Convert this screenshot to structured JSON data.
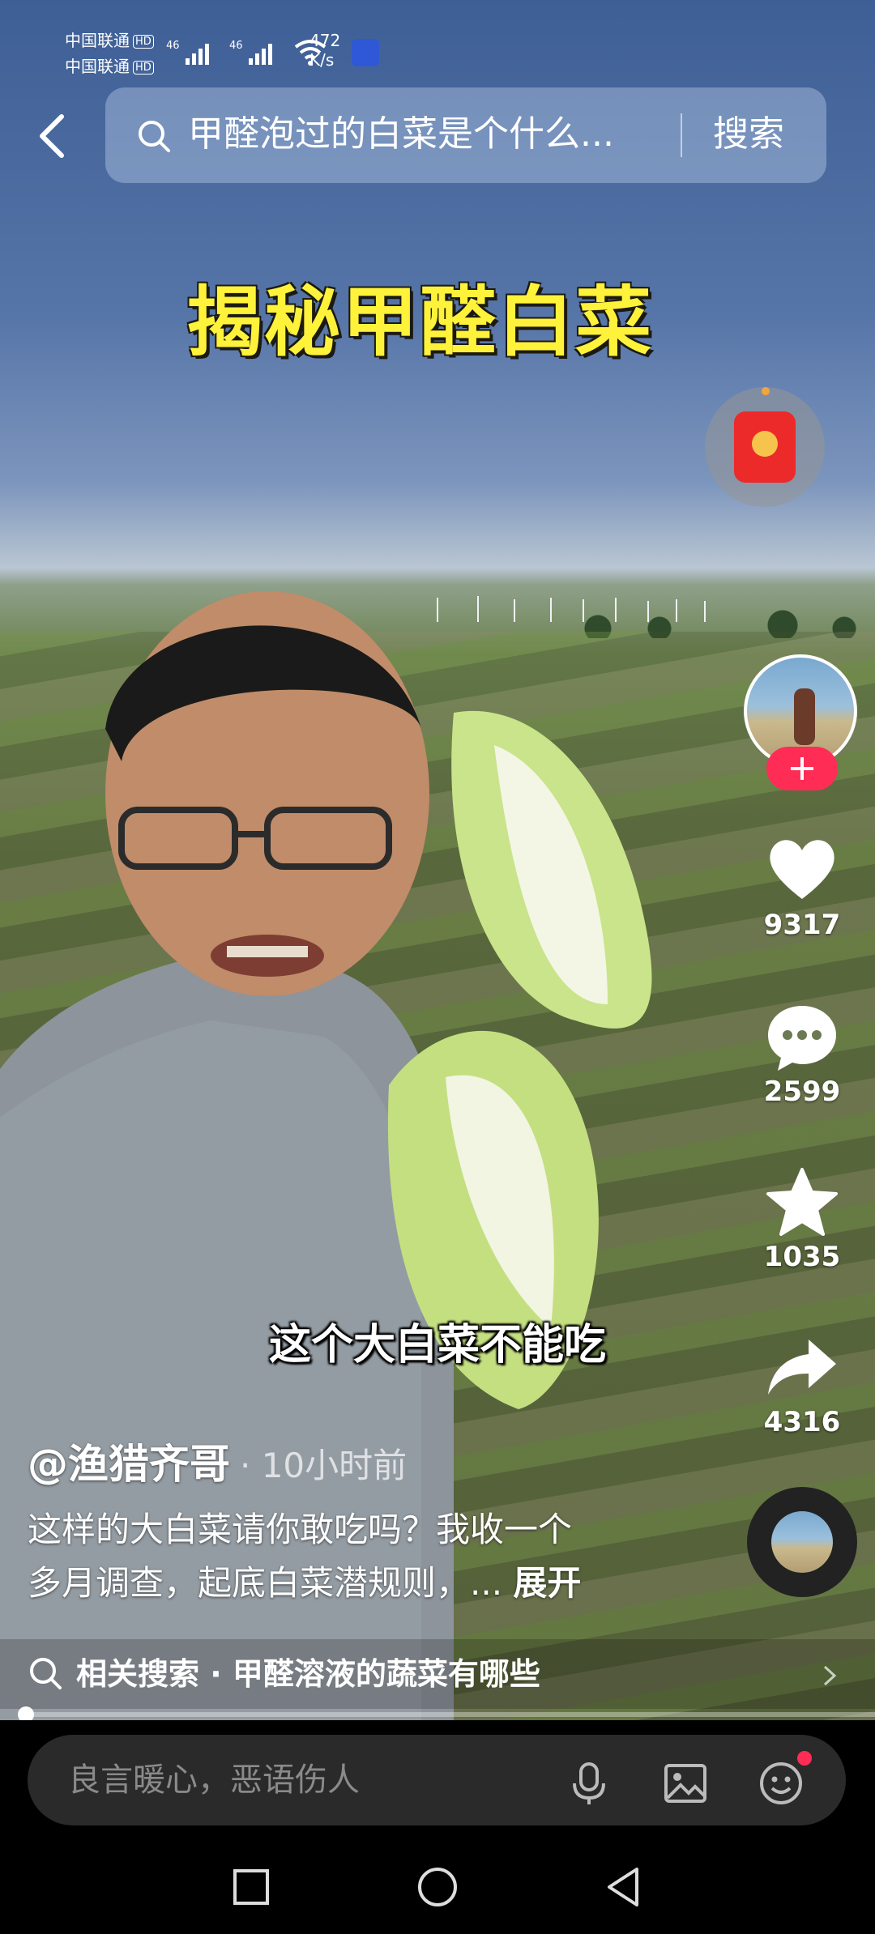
{
  "status_bar": {
    "carrier_1": "中国联通",
    "carrier_2": "中国联通",
    "hd_badge": "HD",
    "net_type": "46",
    "speed_value": "472",
    "speed_unit": "K/s"
  },
  "search": {
    "query": "甲醛泡过的白菜是个什么...",
    "button_label": "搜索"
  },
  "video": {
    "title_overlay": "揭秘甲醛白菜",
    "subtitle": "这个大白菜不能吃"
  },
  "actions": {
    "likes": "9317",
    "comments": "2599",
    "favorites": "1035",
    "shares": "4316"
  },
  "caption": {
    "author": "@渔猎齐哥",
    "time": "· 10小时前",
    "text_line1": "这样的大白菜请你敢吃吗？我收一个",
    "text_line2": "多月调查，起底白菜潜规则，...",
    "more": "展开"
  },
  "related": {
    "text": "相关搜索 · 甲醛溶液的蔬菜有哪些"
  },
  "progress_fraction": 0.0,
  "comment_bar": {
    "placeholder": "良言暖心，恶语伤人"
  },
  "colors": {
    "accent": "#ff2d55",
    "title_yellow": "#fff23a"
  }
}
